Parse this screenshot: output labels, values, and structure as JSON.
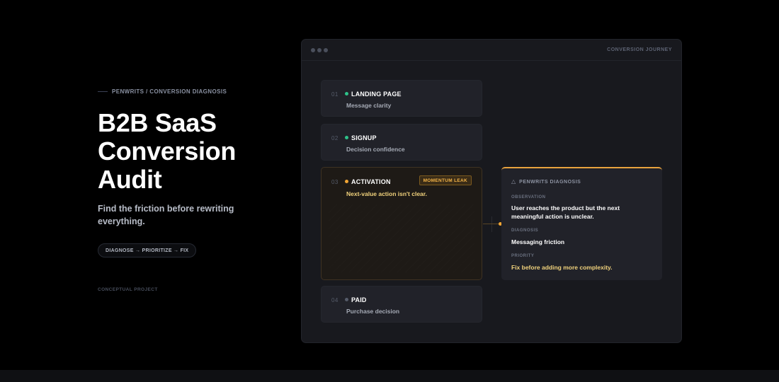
{
  "hero": {
    "eyebrow": "PENWRITS / CONVERSION DIAGNOSIS",
    "title": "B2B SaaS Conversion Audit",
    "subtitle": "Find the friction before rewriting everything.",
    "process_pill": "DIAGNOSE → PRIORITIZE → FIX",
    "footnote": "CONCEPTUAL PROJECT"
  },
  "window": {
    "label": "CONVERSION JOURNEY"
  },
  "stages": [
    {
      "num": "01",
      "title": "LANDING PAGE",
      "desc": "Message clarity",
      "dot_color": "#2ec28a"
    },
    {
      "num": "02",
      "title": "SIGNUP",
      "desc": "Decision confidence",
      "dot_color": "#2ec28a"
    },
    {
      "num": "03",
      "title": "ACTIVATION",
      "desc": "Next-value action isn't clear.",
      "dot_color": "#f1a534",
      "badge": "MOMENTUM LEAK"
    },
    {
      "num": "04",
      "title": "PAID",
      "desc": "Purchase decision",
      "dot_color": "#565c6a"
    }
  ],
  "diagnosis": {
    "heading": "PENWRITS DIAGNOSIS",
    "heading_icon": "warning-triangle-icon",
    "observation_label": "OBSERVATION",
    "observation": "User reaches the product but the next meaningful action is unclear.",
    "diagnosis_label": "DIAGNOSIS",
    "diagnosis": "Messaging friction",
    "priority_label": "PRIORITY",
    "priority": "Fix before adding more complexity."
  },
  "colors": {
    "accent": "#e8a23d",
    "ok": "#2ec28a",
    "warn_text": "#f1d27c",
    "background": "#000000",
    "window": "#18191e"
  }
}
